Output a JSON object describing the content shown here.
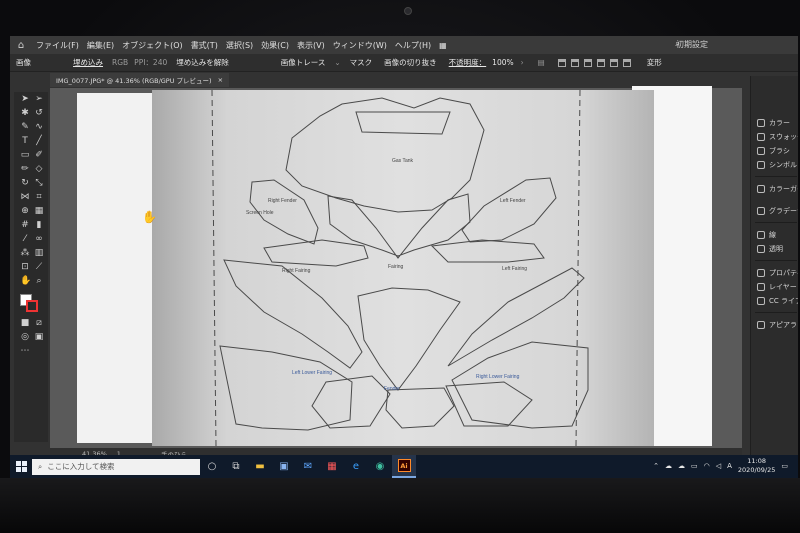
{
  "menubar": {
    "items": [
      "ファイル(F)",
      "編集(E)",
      "オブジェクト(O)",
      "書式(T)",
      "選択(S)",
      "効果(C)",
      "表示(V)",
      "ウィンドウ(W)",
      "ヘルプ(H)"
    ],
    "workspace": "初期設定"
  },
  "controlbar": {
    "label": "画像",
    "embed": "埋め込み",
    "color_mode": "RGB",
    "ppi": "PPI：240",
    "unembed": "埋め込みを解除",
    "image_trace": "画像トレース",
    "mask": "マスク",
    "crop": "画像の切り抜き",
    "opacity_label": "不透明度：",
    "opacity_value": "100%",
    "transform": "変形"
  },
  "document_tab": {
    "title": "IMG_0077.JPG* @ 41.36% (RGB/GPU プレビュー)",
    "close": "×"
  },
  "artwork_labels": {
    "gas_tank": "Gas Tank",
    "right_fender": "Right Fender",
    "left_fender": "Left Fender",
    "screen_hole": "Screen Hole",
    "right_fairing": "Right Fairing",
    "fairing": "Fairing",
    "left_fairing": "Left Fairing",
    "left_lower_fairing": "Left Lower Fairing",
    "right_lower_fairing": "Right Lower Fairing",
    "fender": "Fender"
  },
  "statusbar": {
    "zoom": "41.36%",
    "page": "1",
    "tool": "手のひら"
  },
  "right_panel": {
    "items": [
      "カラー",
      "スウォッチ",
      "ブラシ",
      "シンボル",
      "カラーガイド",
      "グラデーション",
      "線",
      "透明",
      "プロパティ",
      "レイヤー",
      "CC ライブラリ",
      "アピアランス"
    ]
  },
  "taskbar": {
    "search_placeholder": "ここに入力して検索",
    "app_label": "Ai",
    "ime": "A",
    "time": "11:08",
    "date": "2020/09/25"
  }
}
